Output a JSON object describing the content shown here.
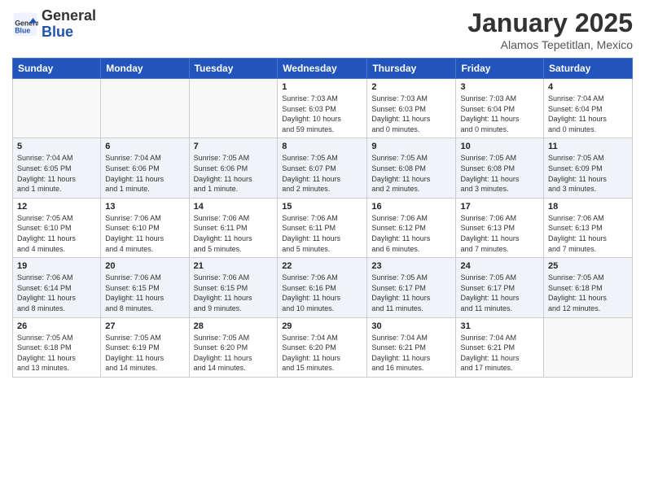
{
  "header": {
    "logo_general": "General",
    "logo_blue": "Blue",
    "month_title": "January 2025",
    "location": "Alamos Tepetitlan, Mexico"
  },
  "weekdays": [
    "Sunday",
    "Monday",
    "Tuesday",
    "Wednesday",
    "Thursday",
    "Friday",
    "Saturday"
  ],
  "weeks": [
    [
      {
        "day": "",
        "info": ""
      },
      {
        "day": "",
        "info": ""
      },
      {
        "day": "",
        "info": ""
      },
      {
        "day": "1",
        "info": "Sunrise: 7:03 AM\nSunset: 6:03 PM\nDaylight: 10 hours\nand 59 minutes."
      },
      {
        "day": "2",
        "info": "Sunrise: 7:03 AM\nSunset: 6:03 PM\nDaylight: 11 hours\nand 0 minutes."
      },
      {
        "day": "3",
        "info": "Sunrise: 7:03 AM\nSunset: 6:04 PM\nDaylight: 11 hours\nand 0 minutes."
      },
      {
        "day": "4",
        "info": "Sunrise: 7:04 AM\nSunset: 6:04 PM\nDaylight: 11 hours\nand 0 minutes."
      }
    ],
    [
      {
        "day": "5",
        "info": "Sunrise: 7:04 AM\nSunset: 6:05 PM\nDaylight: 11 hours\nand 1 minute."
      },
      {
        "day": "6",
        "info": "Sunrise: 7:04 AM\nSunset: 6:06 PM\nDaylight: 11 hours\nand 1 minute."
      },
      {
        "day": "7",
        "info": "Sunrise: 7:05 AM\nSunset: 6:06 PM\nDaylight: 11 hours\nand 1 minute."
      },
      {
        "day": "8",
        "info": "Sunrise: 7:05 AM\nSunset: 6:07 PM\nDaylight: 11 hours\nand 2 minutes."
      },
      {
        "day": "9",
        "info": "Sunrise: 7:05 AM\nSunset: 6:08 PM\nDaylight: 11 hours\nand 2 minutes."
      },
      {
        "day": "10",
        "info": "Sunrise: 7:05 AM\nSunset: 6:08 PM\nDaylight: 11 hours\nand 3 minutes."
      },
      {
        "day": "11",
        "info": "Sunrise: 7:05 AM\nSunset: 6:09 PM\nDaylight: 11 hours\nand 3 minutes."
      }
    ],
    [
      {
        "day": "12",
        "info": "Sunrise: 7:05 AM\nSunset: 6:10 PM\nDaylight: 11 hours\nand 4 minutes."
      },
      {
        "day": "13",
        "info": "Sunrise: 7:06 AM\nSunset: 6:10 PM\nDaylight: 11 hours\nand 4 minutes."
      },
      {
        "day": "14",
        "info": "Sunrise: 7:06 AM\nSunset: 6:11 PM\nDaylight: 11 hours\nand 5 minutes."
      },
      {
        "day": "15",
        "info": "Sunrise: 7:06 AM\nSunset: 6:11 PM\nDaylight: 11 hours\nand 5 minutes."
      },
      {
        "day": "16",
        "info": "Sunrise: 7:06 AM\nSunset: 6:12 PM\nDaylight: 11 hours\nand 6 minutes."
      },
      {
        "day": "17",
        "info": "Sunrise: 7:06 AM\nSunset: 6:13 PM\nDaylight: 11 hours\nand 7 minutes."
      },
      {
        "day": "18",
        "info": "Sunrise: 7:06 AM\nSunset: 6:13 PM\nDaylight: 11 hours\nand 7 minutes."
      }
    ],
    [
      {
        "day": "19",
        "info": "Sunrise: 7:06 AM\nSunset: 6:14 PM\nDaylight: 11 hours\nand 8 minutes."
      },
      {
        "day": "20",
        "info": "Sunrise: 7:06 AM\nSunset: 6:15 PM\nDaylight: 11 hours\nand 8 minutes."
      },
      {
        "day": "21",
        "info": "Sunrise: 7:06 AM\nSunset: 6:15 PM\nDaylight: 11 hours\nand 9 minutes."
      },
      {
        "day": "22",
        "info": "Sunrise: 7:06 AM\nSunset: 6:16 PM\nDaylight: 11 hours\nand 10 minutes."
      },
      {
        "day": "23",
        "info": "Sunrise: 7:05 AM\nSunset: 6:17 PM\nDaylight: 11 hours\nand 11 minutes."
      },
      {
        "day": "24",
        "info": "Sunrise: 7:05 AM\nSunset: 6:17 PM\nDaylight: 11 hours\nand 11 minutes."
      },
      {
        "day": "25",
        "info": "Sunrise: 7:05 AM\nSunset: 6:18 PM\nDaylight: 11 hours\nand 12 minutes."
      }
    ],
    [
      {
        "day": "26",
        "info": "Sunrise: 7:05 AM\nSunset: 6:18 PM\nDaylight: 11 hours\nand 13 minutes."
      },
      {
        "day": "27",
        "info": "Sunrise: 7:05 AM\nSunset: 6:19 PM\nDaylight: 11 hours\nand 14 minutes."
      },
      {
        "day": "28",
        "info": "Sunrise: 7:05 AM\nSunset: 6:20 PM\nDaylight: 11 hours\nand 14 minutes."
      },
      {
        "day": "29",
        "info": "Sunrise: 7:04 AM\nSunset: 6:20 PM\nDaylight: 11 hours\nand 15 minutes."
      },
      {
        "day": "30",
        "info": "Sunrise: 7:04 AM\nSunset: 6:21 PM\nDaylight: 11 hours\nand 16 minutes."
      },
      {
        "day": "31",
        "info": "Sunrise: 7:04 AM\nSunset: 6:21 PM\nDaylight: 11 hours\nand 17 minutes."
      },
      {
        "day": "",
        "info": ""
      }
    ]
  ]
}
